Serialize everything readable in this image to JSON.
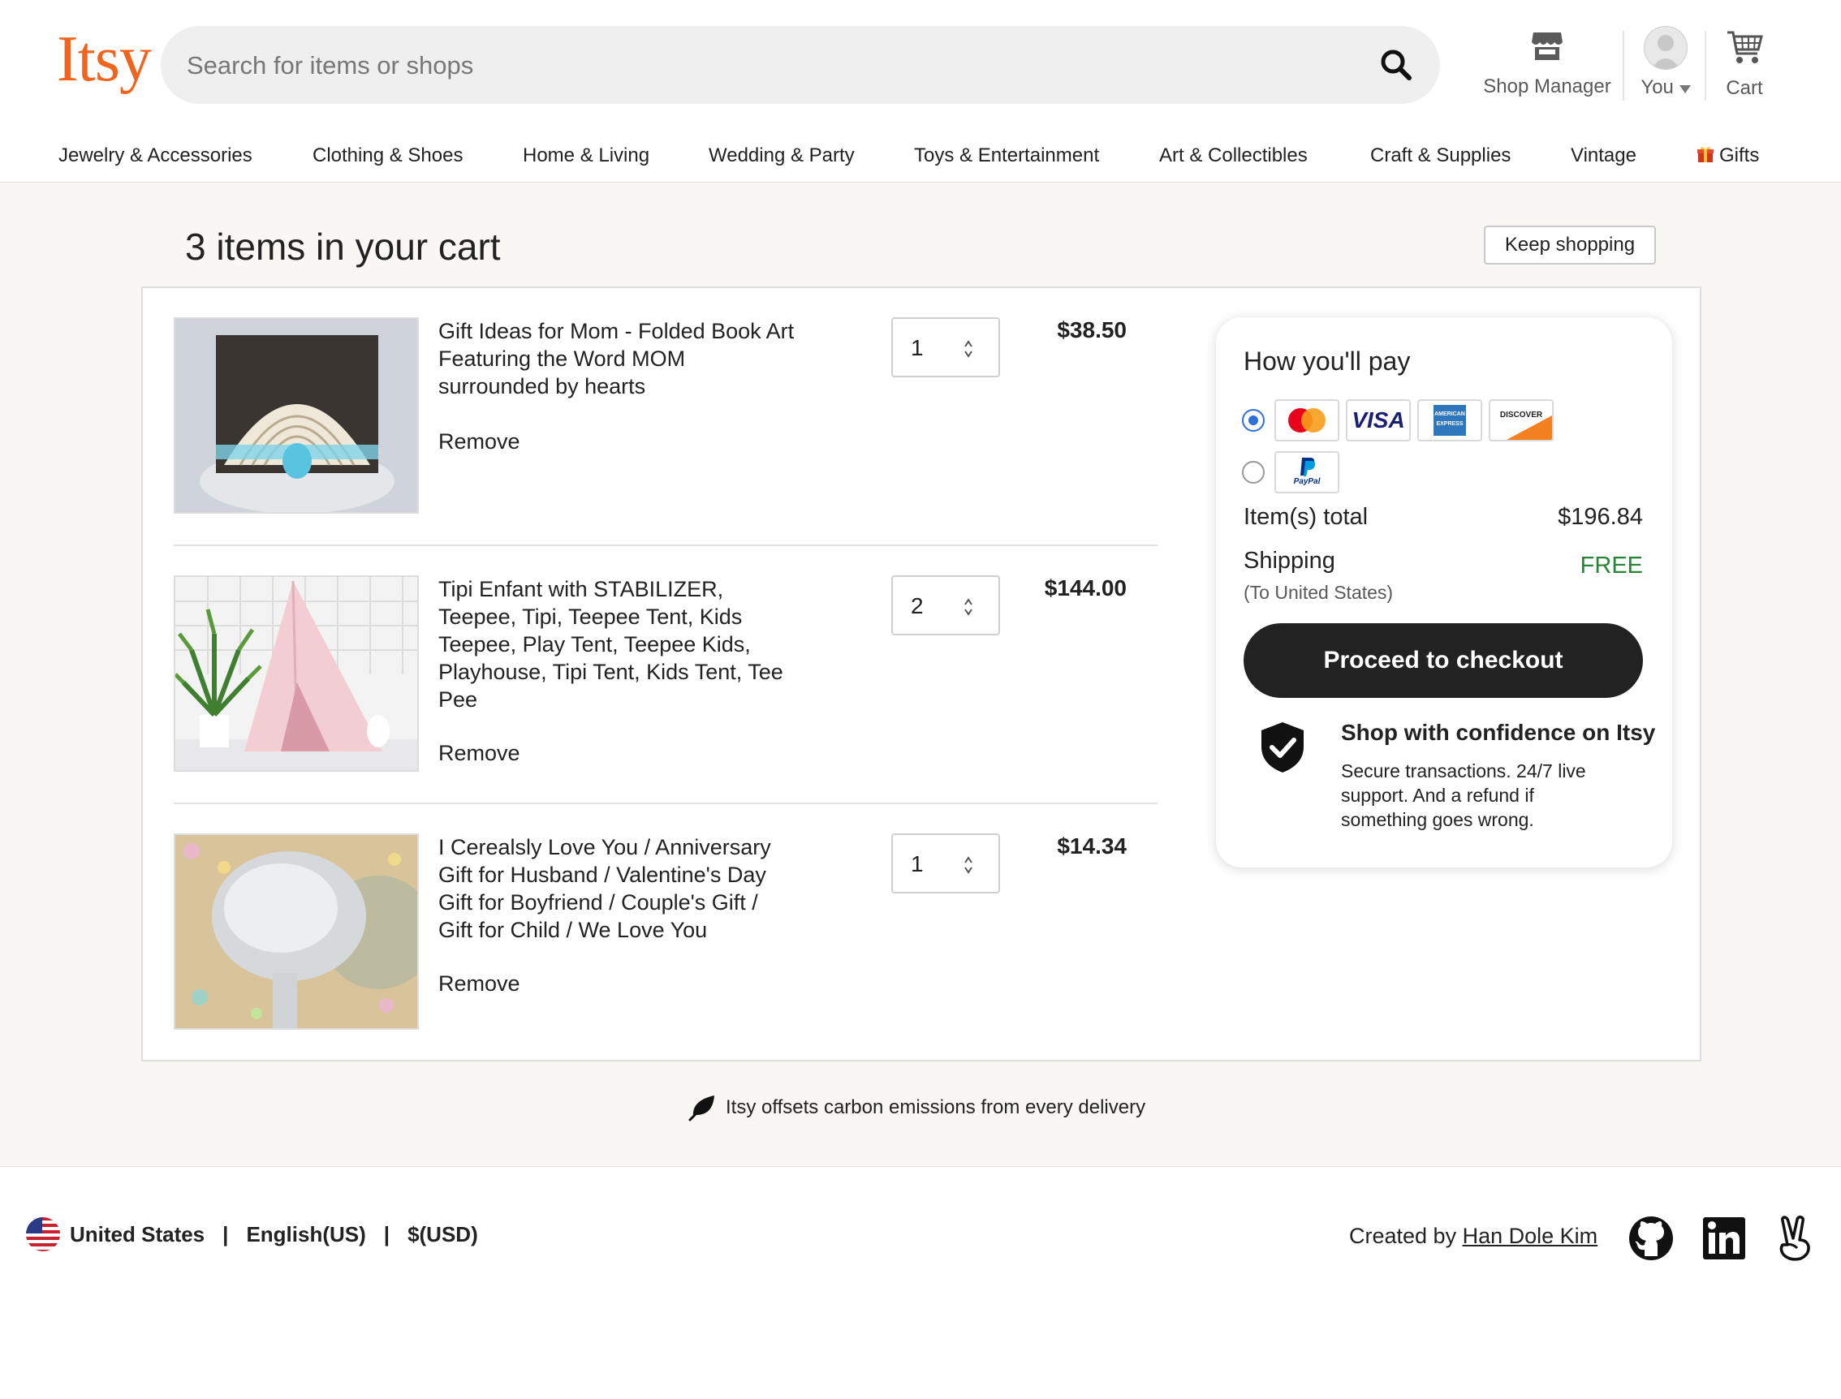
{
  "header": {
    "logo": "Itsy",
    "search_placeholder": "Search for items or shops",
    "shop_manager_label": "Shop Manager",
    "you_label": "You",
    "cart_label": "Cart"
  },
  "nav": {
    "items": [
      "Jewelry & Accessories",
      "Clothing & Shoes",
      "Home & Living",
      "Wedding & Party",
      "Toys & Entertainment",
      "Art & Collectibles",
      "Craft & Supplies",
      "Vintage",
      "Gifts"
    ]
  },
  "cart": {
    "title": "3 items in your cart",
    "keep_shopping": "Keep shopping",
    "remove_label": "Remove",
    "items": [
      {
        "title": "Gift Ideas for Mom - Folded Book Art Featuring the Word MOM surrounded by hearts",
        "quantity": "1",
        "price": "$38.50"
      },
      {
        "title": "Tipi Enfant with STABILIZER, Teepee, Tipi, Teepee Tent, Kids Teepee, Play Tent, Teepee Kids, Playhouse, Tipi Tent, Kids Tent, Tee Pee",
        "quantity": "2",
        "price": "$144.00"
      },
      {
        "title": "I Cerealsly Love You / Anniversary Gift for Husband / Valentine's Day Gift for Boyfriend / Couple's Gift / Gift for Child / We Love You",
        "quantity": "1",
        "price": "$14.34"
      }
    ]
  },
  "payment": {
    "title": "How you'll pay",
    "items_total_label": "Item(s) total",
    "items_total_value": "$196.84",
    "shipping_label": "Shipping",
    "shipping_value": "FREE",
    "shipping_note": "(To United States)",
    "checkout_label": "Proceed to checkout",
    "confidence_title": "Shop with confidence on Itsy",
    "confidence_text": "Secure transactions. 24/7 live support. And a refund if something goes wrong.",
    "card_visa": "VISA",
    "card_amex": "AMERICAN EXPRESS",
    "card_discover": "DISCOVER",
    "card_paypal": "PayPal"
  },
  "carbon_note": "Itsy offsets carbon emissions from every delivery",
  "footer": {
    "country": "United States",
    "language": "English(US)",
    "currency": "$(USD)",
    "separator": "|",
    "credit_prefix": "Created by",
    "credit_name": "Han Dole Kim"
  },
  "colors": {
    "brand": "#f1641e",
    "checkout_bg": "#222222",
    "free_green": "#258635",
    "radio_blue": "#2e6fd8",
    "page_band": "#f8f7f4"
  },
  "icons": [
    "search-icon",
    "shop-icon",
    "avatar",
    "chevron-down-icon",
    "cart-icon",
    "gift-icon",
    "shield-check-icon",
    "leaf-icon",
    "us-flag-icon",
    "github-icon",
    "linkedin-icon",
    "angellist-icon"
  ]
}
